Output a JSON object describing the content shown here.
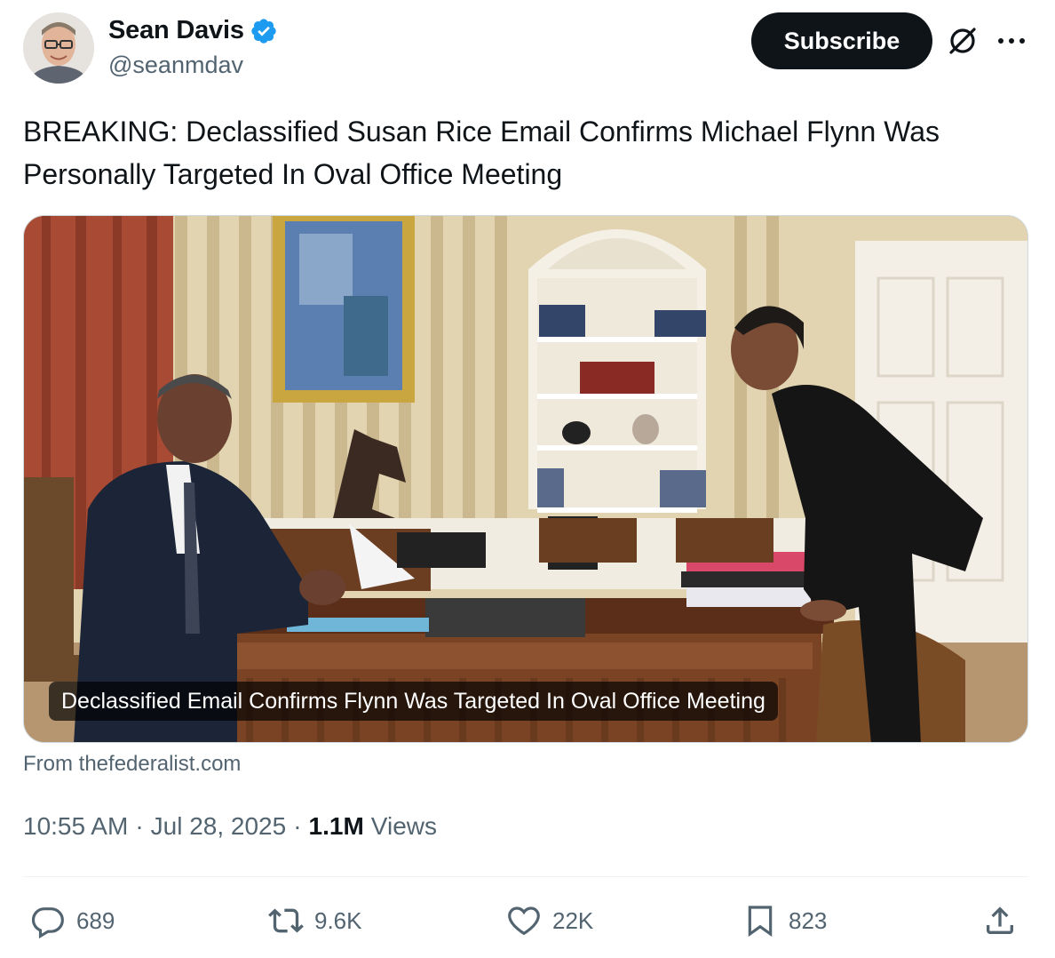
{
  "author": {
    "display_name": "Sean Davis",
    "handle": "@seanmdav",
    "verified": true,
    "avatar_icon": "profile-photo"
  },
  "header": {
    "subscribe_label": "Subscribe",
    "grok_icon": "grok-icon",
    "more_icon": "more-icon"
  },
  "tweet": {
    "text": "BREAKING: Declassified Susan Rice Email Confirms Michael Flynn Was Personally Targeted In Oval Office Meeting"
  },
  "card": {
    "caption": "Declassified Email Confirms Flynn Was Targeted In Oval Office Meeting",
    "source": "From thefederalist.com"
  },
  "meta": {
    "time": "10:55 AM",
    "date": "Jul 28, 2025",
    "views_count": "1.1M",
    "views_label": "Views"
  },
  "actions": {
    "replies": "689",
    "reposts": "9.6K",
    "likes": "22K",
    "bookmarks": "823"
  },
  "colors": {
    "text_primary": "#0f1419",
    "text_secondary": "#536471",
    "verified_blue": "#1d9bf0",
    "border": "#cfd9de"
  }
}
